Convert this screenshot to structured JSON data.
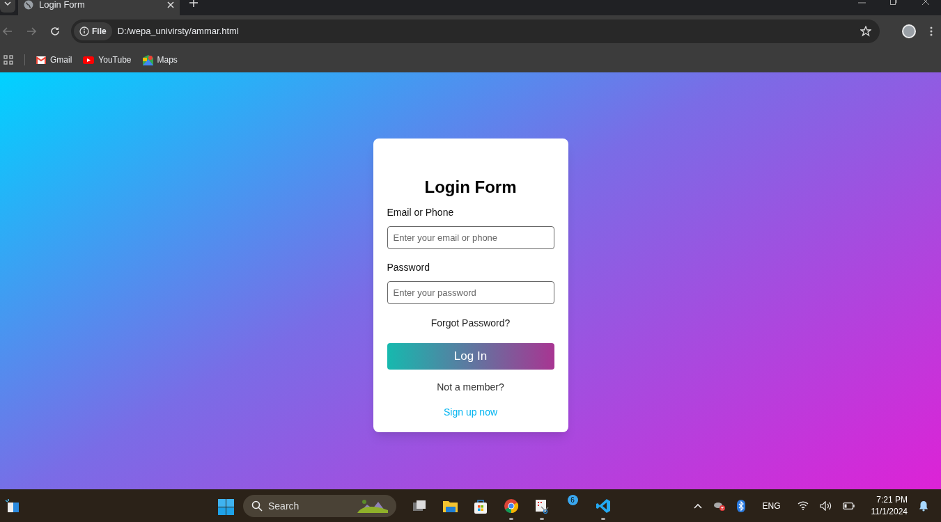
{
  "browser": {
    "tab": {
      "title": "Login Form"
    },
    "address": {
      "scheme": "File",
      "url": "D:/wepa_univirsty/ammar.html"
    },
    "bookmarks": [
      {
        "kind": "gmail",
        "label": "Gmail"
      },
      {
        "kind": "youtube",
        "label": "YouTube"
      },
      {
        "kind": "maps",
        "label": "Maps"
      }
    ]
  },
  "form": {
    "title": "Login Form",
    "fields": [
      {
        "label": "Email or Phone",
        "placeholder": "Enter your email or phone"
      },
      {
        "label": "Password",
        "placeholder": "Enter your password"
      }
    ],
    "forgot": "Forgot Password?",
    "submit": "Log In",
    "prompt": "Not a member?",
    "signup": "Sign up now"
  },
  "taskbar": {
    "search": {
      "placeholder": "Search"
    },
    "apps": [
      {
        "kind": "taskview",
        "running": false
      },
      {
        "kind": "explorer",
        "running": false
      },
      {
        "kind": "store",
        "running": false
      },
      {
        "kind": "chrome",
        "running": true
      },
      {
        "kind": "snip",
        "running": true
      },
      {
        "kind": "badge",
        "count": "6"
      },
      {
        "kind": "vscode",
        "running": true
      }
    ],
    "language": "ENG",
    "time": "7:21 PM",
    "date": "11/1/2024"
  }
}
